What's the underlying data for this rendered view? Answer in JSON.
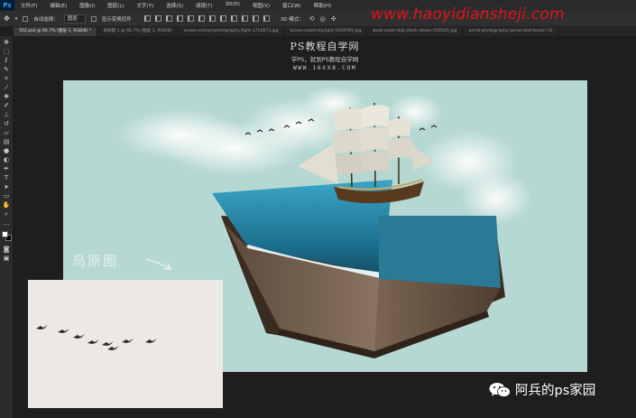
{
  "app": {
    "logo": "Ps"
  },
  "menu": [
    "文件(F)",
    "编辑(E)",
    "图像(I)",
    "图层(L)",
    "文字(Y)",
    "选择(S)",
    "滤镜(T)",
    "3D(D)",
    "视图(V)",
    "窗口(W)",
    "帮助(H)"
  ],
  "options": {
    "auto_select_label": "自动选择：",
    "auto_select_value": "图层",
    "show_transform_label": "显示变换控件",
    "mode_3d_label": "3D 模式："
  },
  "tabs": [
    "502.psd @ 66.7% (图层 1, RGB/8) *",
    "未标题-1 @ 66.7% (图层 1, RGB/8)",
    "ocean-animal-photography-fight-1710873.jpg",
    "ocean-coast-daylight-1656769.jpg",
    "boat-sailer-ship-stock-steam-556545.jpg",
    "aerial-photography-aerial-shot-beach-1S"
  ],
  "watermark": "www.haoyidiansheji.com",
  "tutorial": {
    "title": "PS教程自学网",
    "subtitle": "学PS，就到PS教程自学网",
    "url": "WWW.16XX8.COM"
  },
  "annotation": "鸟原图",
  "credit": {
    "text": "阿兵的ps家园"
  },
  "colors": {
    "canvas_bg": "#b6d8d2",
    "foreground": "#ffffff",
    "background": "#000000",
    "watermark": "#e0141e"
  }
}
